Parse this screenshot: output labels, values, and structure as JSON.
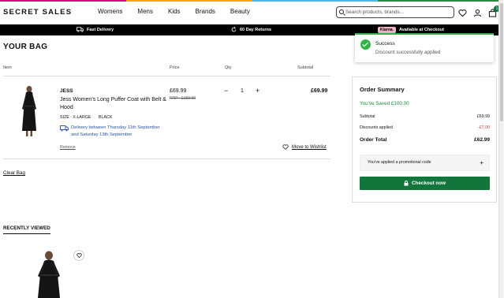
{
  "colors": {
    "accent_green": "#12763c",
    "success_green": "#34b24a",
    "delivery_blue": "#2353a8",
    "discount_red": "#d33333",
    "stripe": [
      "#e6007e",
      "#f7a600",
      "#4fb8e6",
      "#2b8a3e"
    ]
  },
  "header": {
    "logo": "SECRET SALES",
    "nav": [
      "Womens",
      "Mens",
      "Kids",
      "Brands",
      "Beauty"
    ],
    "search_placeholder": "Search products, brands...",
    "bag_count": "1",
    "icons": [
      "search-icon",
      "heart-icon",
      "user-icon",
      "bag-icon"
    ]
  },
  "promo_bar": {
    "fast_delivery": "Fast Delivery",
    "returns": "60 Day Returns",
    "klarna_badge": "Klarna.",
    "klarna_text": "Available at Checkout"
  },
  "toast": {
    "title": "Success",
    "message": "Discount successfully applied"
  },
  "bag": {
    "title": "YOUR BAG",
    "columns": {
      "item": "Item",
      "price": "Price",
      "qty": "Qty",
      "subtotal": "Subtotal"
    },
    "item": {
      "brand": "JESS",
      "name": "Jess Women's Long Puffer Coat with Belt & Hood",
      "size": "SIZE : X-LARGE",
      "color": "BLACK",
      "delivery": "Delivery between Thursday 11th September and Saturday 13th September",
      "remove": "Remove",
      "price": "£69.99",
      "rrp": "RRP - £169.99",
      "qty_minus": "−",
      "qty": "1",
      "qty_plus": "+",
      "subtotal": "£69.99",
      "wishlist": "Move to Wishlist"
    },
    "clear": "Clear Bag"
  },
  "summary": {
    "title": "Order Summary",
    "saved": "You've Saved  £100.00",
    "subtotal_label": "Subtotal",
    "subtotal_value": "£69.99",
    "discount_label": "Discounts applied",
    "discount_value": "-£7.00",
    "total_label": "Order Total",
    "total_value": "£62.99",
    "promo": "You've applied a promotional code",
    "promo_plus": "+",
    "checkout": "Checkout now"
  },
  "recently_viewed": {
    "title": "RECENTLY VIEWED"
  }
}
